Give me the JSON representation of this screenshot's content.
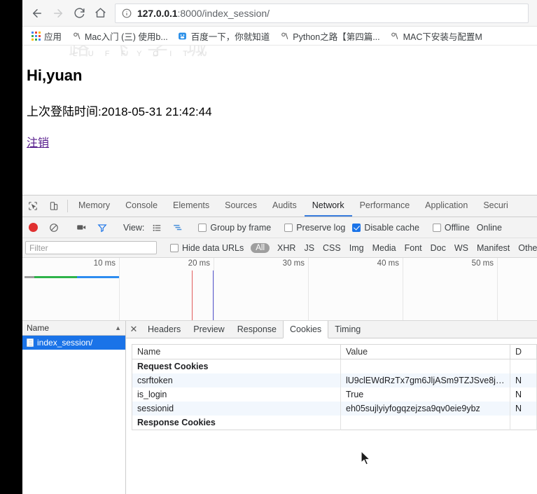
{
  "browser": {
    "nav": {
      "back": "back-arrow",
      "forward": "forward-arrow",
      "reload": "reload",
      "home": "home"
    },
    "omnibox": {
      "info_icon": "info-circle-icon",
      "url_host": "127.0.0.1",
      "url_rest": ":8000/index_session/",
      "full_url": "127.0.0.1:8000/index_session/"
    },
    "bookmarks": [
      {
        "label": "应用",
        "icon": "apps-grid-icon"
      },
      {
        "label": "Mac入门 (三) 使用b...",
        "icon": "generic-bookmark-icon"
      },
      {
        "label": "百度一下，你就知道",
        "icon": "baidu-icon"
      },
      {
        "label": "Python之路【第四篇...",
        "icon": "generic-bookmark-icon"
      },
      {
        "label": "MAC下安装与配置M",
        "icon": "generic-bookmark-icon"
      }
    ]
  },
  "page": {
    "watermark_latin": "L U F F Y C I T Y",
    "watermark_cjk": "路飞学城",
    "greeting": "Hi,yuan",
    "last_login": "上次登陆时间:2018-05-31 21:42:44",
    "logout_link": "注销"
  },
  "devtools": {
    "tabs": [
      {
        "label": "Memory",
        "active": false
      },
      {
        "label": "Console",
        "active": false
      },
      {
        "label": "Elements",
        "active": false
      },
      {
        "label": "Sources",
        "active": false
      },
      {
        "label": "Audits",
        "active": false
      },
      {
        "label": "Network",
        "active": true
      },
      {
        "label": "Performance",
        "active": false
      },
      {
        "label": "Application",
        "active": false
      },
      {
        "label": "Securi",
        "active": false
      }
    ],
    "toolbar": {
      "record_icon": "record-circle-icon",
      "clear_icon": "clear-prohibited-icon",
      "camera_icon": "camera-icon",
      "filter_icon": "funnel-filter-icon",
      "view_label": "View:",
      "view_list_icon": "list-view-icon",
      "view_waterfall_icon": "waterfall-view-icon",
      "group_by_frame": {
        "label": "Group by frame",
        "checked": false
      },
      "preserve_log": {
        "label": "Preserve log",
        "checked": false
      },
      "disable_cache": {
        "label": "Disable cache",
        "checked": true
      },
      "offline": {
        "label": "Offline",
        "checked": false
      },
      "online": {
        "label": "Online"
      }
    },
    "filterbar": {
      "filter_placeholder": "Filter",
      "filter_value": "",
      "hide_data_urls": {
        "label": "Hide data URLs",
        "checked": false
      },
      "types": [
        "All",
        "XHR",
        "JS",
        "CSS",
        "Img",
        "Media",
        "Font",
        "Doc",
        "WS",
        "Manifest",
        "Othe"
      ],
      "active_type": "All"
    },
    "overview": {
      "ticks": [
        "10 ms",
        "20 ms",
        "30 ms",
        "40 ms",
        "50 ms"
      ],
      "bar_colors": [
        "#9e9e9e",
        "#2eb34a",
        "#2d8cf0"
      ],
      "marker_colors": [
        "#e25c5c",
        "#5b5bd6"
      ]
    },
    "requests": {
      "column_header": "Name",
      "sort_indicator": "▲",
      "rows": [
        {
          "name": "index_session/",
          "icon": "document-icon",
          "selected": true
        }
      ]
    },
    "detail": {
      "close_label": "✕",
      "tabs": [
        {
          "label": "Headers",
          "active": false
        },
        {
          "label": "Preview",
          "active": false
        },
        {
          "label": "Response",
          "active": false
        },
        {
          "label": "Cookies",
          "active": true
        },
        {
          "label": "Timing",
          "active": false
        }
      ],
      "cookies_table": {
        "headers": [
          "Name",
          "Value",
          "D"
        ],
        "rows": [
          {
            "type": "group",
            "name": "Request Cookies",
            "value": "",
            "domain": ""
          },
          {
            "type": "cookie",
            "name": "csrftoken",
            "value": "lU9clEWdRzTx7gm6JljASm9TZJSve8jU...",
            "domain": "N"
          },
          {
            "type": "cookie",
            "name": "is_login",
            "value": "True",
            "domain": "N"
          },
          {
            "type": "cookie",
            "name": "sessionid",
            "value": "eh05sujlyiyfogqzejzsa9qv0eie9ybz",
            "domain": "N"
          },
          {
            "type": "group",
            "name": "Response Cookies",
            "value": "",
            "domain": ""
          }
        ]
      }
    }
  },
  "colors": {
    "accent_blue": "#1a73e8",
    "tab_underline": "#3b7ddd",
    "record_red": "#e03030",
    "link_purple": "#551a8b",
    "watermark_gray": "#dedede"
  }
}
